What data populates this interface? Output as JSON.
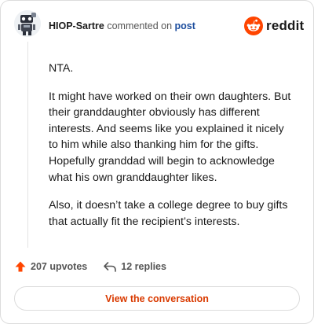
{
  "header": {
    "username": "HIOP-Sartre",
    "commented_on": "commented on",
    "post_link": "post",
    "brand": "reddit"
  },
  "comment": {
    "paragraphs": [
      "NTA.",
      "It might have worked on their own daughters. But their granddaughter obviously has different interests. And seems like you explained it nicely to him while also thanking him for the gifts. Hopefully granddad will begin to acknowledge what his own granddaughter likes.",
      "Also, it doesn’t take a college degree to buy gifts that actually fit the recipient’s interests."
    ]
  },
  "actions": {
    "upvotes": "207 upvotes",
    "replies": "12 replies"
  },
  "cta": {
    "label": "View the conversation"
  },
  "icons": {
    "avatar": "robot-avatar",
    "logo": "reddit-snoo-icon",
    "upvote": "upvote-arrow-icon",
    "reply": "reply-arrow-icon"
  },
  "colors": {
    "brand_orange": "#ff4500",
    "upvote_orange": "#ff4500",
    "link_blue": "#1d4e9e",
    "cta_text": "#d93a00"
  }
}
